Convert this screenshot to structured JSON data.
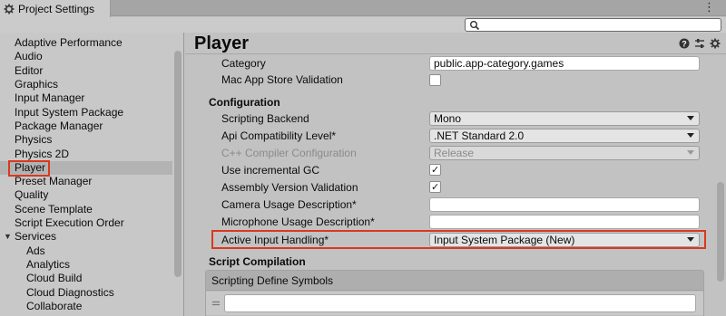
{
  "window": {
    "tab_title": "Project Settings"
  },
  "search": {
    "placeholder": ""
  },
  "sidebar": {
    "items": [
      {
        "label": "Adaptive Performance"
      },
      {
        "label": "Audio"
      },
      {
        "label": "Editor"
      },
      {
        "label": "Graphics"
      },
      {
        "label": "Input Manager"
      },
      {
        "label": "Input System Package"
      },
      {
        "label": "Package Manager"
      },
      {
        "label": "Physics"
      },
      {
        "label": "Physics 2D"
      },
      {
        "label": "Player"
      },
      {
        "label": "Preset Manager"
      },
      {
        "label": "Quality"
      },
      {
        "label": "Scene Template"
      },
      {
        "label": "Script Execution Order"
      },
      {
        "label": "Services"
      },
      {
        "label": "Ads"
      },
      {
        "label": "Analytics"
      },
      {
        "label": "Cloud Build"
      },
      {
        "label": "Cloud Diagnostics"
      },
      {
        "label": "Collaborate"
      }
    ],
    "selected": "Player"
  },
  "main": {
    "title": "Player",
    "rows": {
      "category": {
        "label": "Category",
        "value": "public.app-category.games"
      },
      "mac_app_store_validation": {
        "label": "Mac App Store Validation",
        "checked": false
      },
      "configuration": {
        "label": "Configuration"
      },
      "scripting_backend": {
        "label": "Scripting Backend",
        "value": "Mono"
      },
      "api_compat": {
        "label": "Api Compatibility Level*",
        "value": ".NET Standard 2.0"
      },
      "cpp_compiler": {
        "label": "C++ Compiler Configuration",
        "value": "Release"
      },
      "incremental_gc": {
        "label": "Use incremental GC",
        "checked": true
      },
      "assembly_version": {
        "label": "Assembly Version Validation",
        "checked": true
      },
      "camera_usage": {
        "label": "Camera Usage Description*",
        "value": ""
      },
      "microphone_usage": {
        "label": "Microphone Usage Description*",
        "value": ""
      },
      "active_input": {
        "label": "Active Input Handling*",
        "value": "Input System Package (New)"
      },
      "script_compilation": {
        "label": "Script Compilation"
      },
      "scripting_define_symbols": {
        "label": "Scripting Define Symbols"
      }
    }
  },
  "colors": {
    "highlight": "#d9391f",
    "background": "#c2c2c2"
  }
}
